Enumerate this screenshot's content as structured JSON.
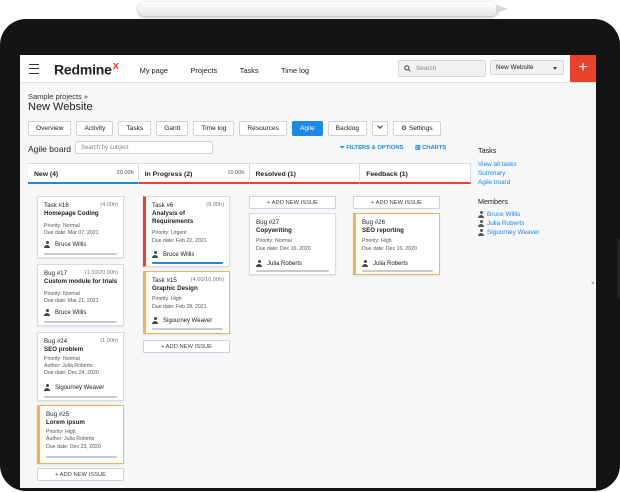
{
  "header": {
    "logo": "Redmine",
    "logo_mark": "x",
    "nav": [
      "My page",
      "Projects",
      "Tasks",
      "Time log"
    ],
    "search_placeholder": "Search",
    "project_select": "New Website",
    "plus": "+"
  },
  "page": {
    "breadcrumb": "Sample projects »",
    "title": "New Website"
  },
  "tabs": [
    {
      "label": "Overview"
    },
    {
      "label": "Activity"
    },
    {
      "label": "Tasks"
    },
    {
      "label": "Gantt"
    },
    {
      "label": "Time log"
    },
    {
      "label": "Resources"
    },
    {
      "label": "Agile",
      "active": true
    },
    {
      "label": "Backlog"
    }
  ],
  "settings_label": "Settings",
  "board": {
    "title": "Agile board",
    "search_placeholder": "Search by subject",
    "filters_label": "FILTERS & OPTIONS",
    "charts_label": "CHARTS"
  },
  "columns": [
    {
      "name": "New (4)",
      "hours": "20.00h"
    },
    {
      "name": "In Progress (2)",
      "hours": "10.00h"
    },
    {
      "name": "Resolved (1)",
      "hours": ""
    },
    {
      "name": "Feedback (1)",
      "hours": ""
    }
  ],
  "add_issue_label": "+ ADD NEW ISSUE",
  "cards": {
    "new": [
      {
        "id": "Task #16",
        "hours": "(4.00h)",
        "name": "Homepage Coding",
        "meta1": "Priority: Normal",
        "meta2": "Due date: Mar 07, 2021",
        "assignee": "Bruce Willis"
      },
      {
        "id": "Bug #17",
        "hours": "(1.00/20.00h)",
        "name": "Custom module for trials",
        "meta1": "Priority: Normal",
        "meta2": "Due date: Mar 21, 2021",
        "assignee": "Bruce Willis"
      },
      {
        "id": "Bug #24",
        "hours": "(1.00h)",
        "name": "SEO problem",
        "meta1": "Priority: Normal",
        "meta2": "Author: Julia Roberts",
        "meta3": "Due date: Dec 24, 2020",
        "assignee": "Sigourney Weaver"
      },
      {
        "id": "Bug #25",
        "hours": "",
        "name": "Lorem ipsum",
        "meta1": "Priority: High",
        "meta2": "Author: Julia Roberts",
        "meta3": "Due date: Dec 23, 2020",
        "assignee": ""
      }
    ],
    "progress": [
      {
        "id": "Task #6",
        "hours": "(9.00h)",
        "name": "Analysis of Requirements",
        "meta1": "Priority: Urgent",
        "meta2": "Due date: Feb 22, 2021",
        "assignee": "Bruce Willis"
      },
      {
        "id": "Task #15",
        "hours": "(4.00/10.00h)",
        "name": "Graphic Design",
        "meta1": "Priority: High",
        "meta2": "Due date: Feb 28, 2021",
        "assignee": "Sigourney Weaver"
      }
    ],
    "resolved": [
      {
        "id": "Bug #27",
        "hours": "",
        "name": "Copywriting",
        "meta1": "Priority: Normal",
        "meta2": "Due date: Dec 16, 2020",
        "assignee": "Julia Roberts"
      }
    ],
    "feedback": [
      {
        "id": "Bug #26",
        "hours": "",
        "name": "SEO reporting",
        "meta1": "Priority: High",
        "meta2": "Due date: Dec 16, 2020",
        "assignee": "Julia Roberts"
      }
    ]
  },
  "sidebar": {
    "tasks_heading": "Tasks",
    "task_links": [
      "View all tasks",
      "Summary",
      "Agile board"
    ],
    "members_heading": "Members",
    "members": [
      "Bruce Willis",
      "Julia Roberts",
      "Sigourney Weaver"
    ]
  },
  "colors": {
    "accent": "#1e88e5",
    "brand": "#e8412c",
    "warning": "#f0922f"
  }
}
